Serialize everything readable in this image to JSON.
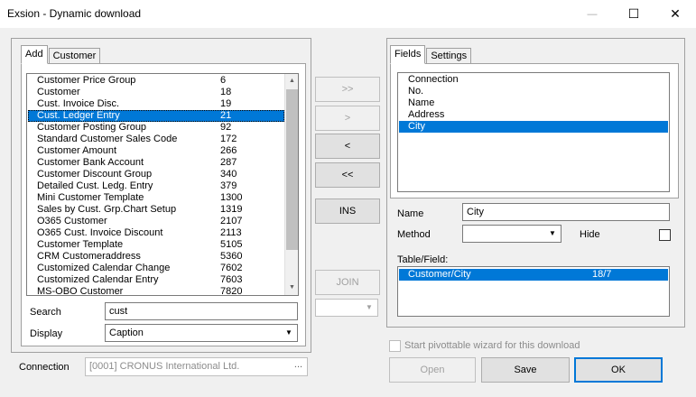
{
  "window": {
    "title": "Exsion - Dynamic download",
    "minimize_glyph": "—",
    "maximize_glyph": "☐",
    "close_glyph": "✕"
  },
  "left_tabs": [
    {
      "label": "Add",
      "active": true
    },
    {
      "label": "Customer",
      "active": false
    }
  ],
  "table_list": {
    "rows": [
      {
        "name": "Customer Price Group",
        "id": "6"
      },
      {
        "name": "Customer",
        "id": "18"
      },
      {
        "name": "Cust. Invoice Disc.",
        "id": "19"
      },
      {
        "name": "Cust. Ledger Entry",
        "id": "21"
      },
      {
        "name": "Customer Posting Group",
        "id": "92"
      },
      {
        "name": "Standard Customer Sales Code",
        "id": "172"
      },
      {
        "name": "Customer Amount",
        "id": "266"
      },
      {
        "name": "Customer Bank Account",
        "id": "287"
      },
      {
        "name": "Customer Discount Group",
        "id": "340"
      },
      {
        "name": "Detailed Cust. Ledg. Entry",
        "id": "379"
      },
      {
        "name": "Mini Customer Template",
        "id": "1300"
      },
      {
        "name": "Sales by Cust. Grp.Chart Setup",
        "id": "1319"
      },
      {
        "name": "O365 Customer",
        "id": "2107"
      },
      {
        "name": "O365 Cust. Invoice Discount",
        "id": "2113"
      },
      {
        "name": "Customer Template",
        "id": "5105"
      },
      {
        "name": "CRM Customeraddress",
        "id": "5360"
      },
      {
        "name": "Customized Calendar Change",
        "id": "7602"
      },
      {
        "name": "Customized Calendar Entry",
        "id": "7603"
      },
      {
        "name": "MS-OBO Customer",
        "id": "7820"
      }
    ],
    "selected_index": 3
  },
  "search": {
    "label": "Search",
    "value": "cust"
  },
  "display": {
    "label": "Display",
    "value": "Caption"
  },
  "connection": {
    "label": "Connection",
    "value": "[0001] CRONUS International Ltd.",
    "browse_label": "..."
  },
  "move_buttons": {
    "add_all": ">>",
    "add": ">",
    "remove": "<",
    "remove_all": "<<",
    "ins": "INS",
    "join": "JOIN"
  },
  "right_tabs": [
    {
      "label": "Fields",
      "active": true
    },
    {
      "label": "Settings",
      "active": false
    }
  ],
  "fields_list": {
    "items": [
      "Connection",
      "No.",
      "Name",
      "Address",
      "City"
    ],
    "selected_index": 4
  },
  "field_name": {
    "label": "Name",
    "value": "City"
  },
  "method": {
    "label": "Method",
    "value": ""
  },
  "hide": {
    "label": "Hide"
  },
  "table_field": {
    "label": "Table/Field:",
    "rows": [
      {
        "path": "Customer/City",
        "ref": "18/7"
      }
    ]
  },
  "pivot": {
    "label": "Start pivottable wizard for this download"
  },
  "footer_buttons": {
    "open": "Open",
    "save": "Save",
    "ok": "OK"
  }
}
